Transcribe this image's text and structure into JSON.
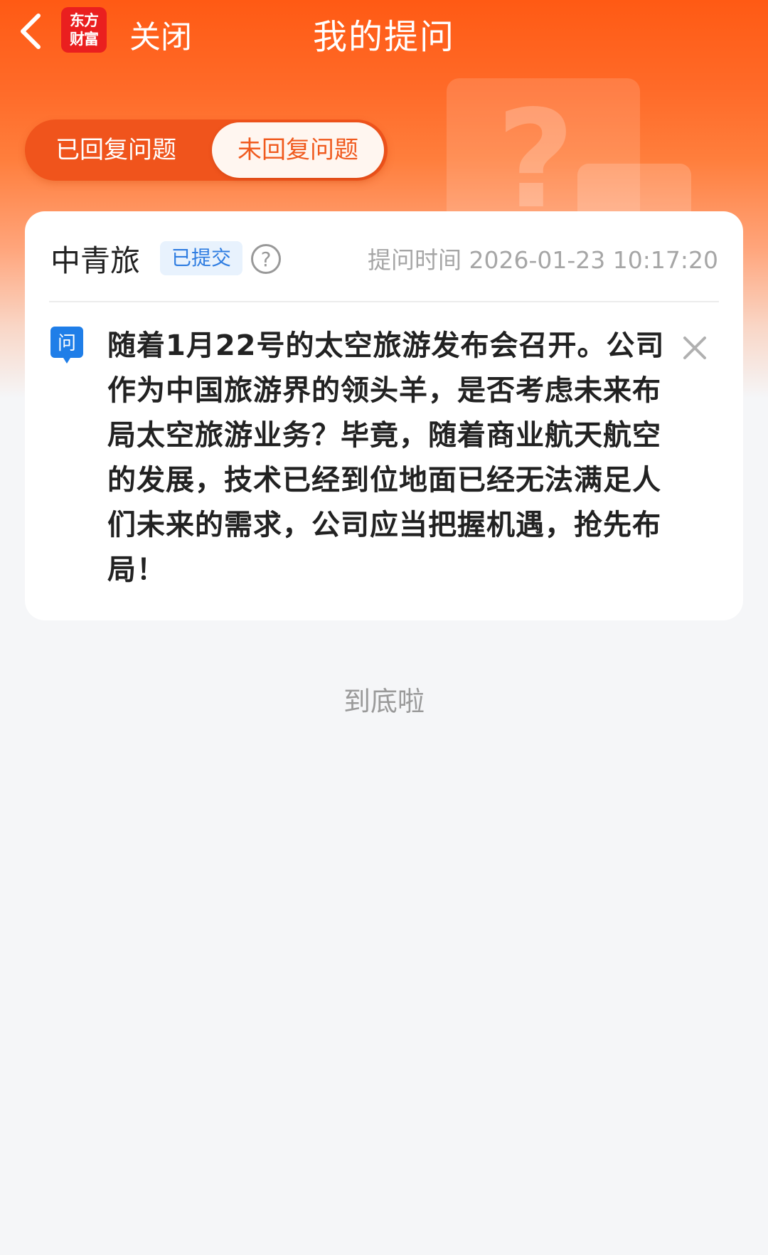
{
  "header": {
    "back_icon": "chevron-left-icon",
    "app_logo_line1": "东方",
    "app_logo_line2": "财富",
    "close_label": "关闭",
    "title": "我的提问"
  },
  "tabs": [
    {
      "label": "已回复问题",
      "active": false
    },
    {
      "label": "未回复问题",
      "active": true
    }
  ],
  "question_card": {
    "company": "中青旅",
    "status": "已提交",
    "help_icon": "question-circle-icon",
    "time_label": "提问时间",
    "time_value": "2026-01-23 10:17:20",
    "question_icon_label": "问",
    "question_text": "随着1月22号的太空旅游发布会召开。公司作为中国旅游界的领头羊，是否考虑未来布局太空旅游业务？毕竟，随着商业航天航空的发展，技术已经到位地面已经无法满足人们未来的需求，公司应当把握机遇，抢先布局！",
    "close_icon": "close-icon"
  },
  "footer": {
    "end_text": "到底啦"
  },
  "colors": {
    "brand_orange": "#ff5a14",
    "active_tab_text": "#f05a1e",
    "badge_blue": "#2f7de1",
    "logo_red": "#ea1f1f"
  }
}
